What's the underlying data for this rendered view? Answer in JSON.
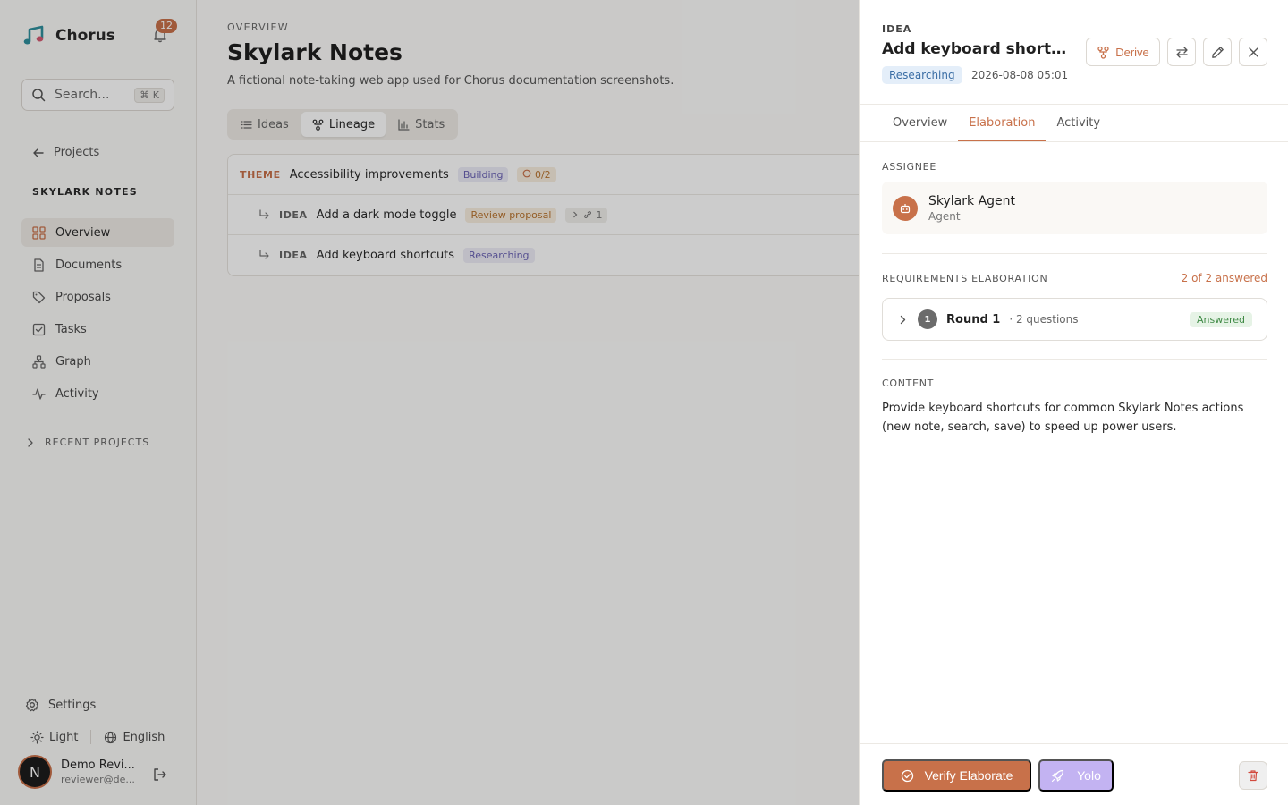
{
  "app": {
    "name": "Chorus",
    "notification_count": "12"
  },
  "colors": {
    "accent": "#c8714a",
    "overlay": "rgba(0,0,0,0.2)",
    "researching_bg": "#e4eef9",
    "yolo": "#c3b3f2"
  },
  "sidebar": {
    "search_placeholder": "Search...",
    "search_shortcut": "⌘ K",
    "back_label": "Projects",
    "project_heading": "SKYLARK NOTES",
    "nav": [
      {
        "label": "Overview",
        "icon": "grid-icon"
      },
      {
        "label": "Documents",
        "icon": "document-icon"
      },
      {
        "label": "Proposals",
        "icon": "tag-icon"
      },
      {
        "label": "Tasks",
        "icon": "checkbox-icon"
      },
      {
        "label": "Graph",
        "icon": "graph-icon"
      },
      {
        "label": "Activity",
        "icon": "pulse-icon"
      }
    ],
    "recent_label": "RECENT PROJECTS",
    "settings_label": "Settings",
    "theme_label": "Light",
    "language_label": "English",
    "user": {
      "initial": "N",
      "name": "Demo Revi...",
      "email": "reviewer@de..."
    }
  },
  "main": {
    "eyebrow": "OVERVIEW",
    "title": "Skylark Notes",
    "description": "A fictional note-taking web app used for Chorus documentation screenshots.",
    "tabs": [
      {
        "label": "Ideas",
        "icon": "list-icon"
      },
      {
        "label": "Lineage",
        "icon": "lineage-icon"
      },
      {
        "label": "Stats",
        "icon": "bar-chart-icon"
      }
    ],
    "lineage": {
      "theme": {
        "kind": "THEME",
        "title": "Accessibility improvements",
        "status": "Building",
        "progress": "0/2"
      },
      "ideas": [
        {
          "kind": "IDEA",
          "title": "Add a dark mode toggle",
          "status": "Review proposal",
          "links": "1"
        },
        {
          "kind": "IDEA",
          "title": "Add keyboard shortcuts",
          "status": "Researching"
        }
      ]
    }
  },
  "drawer": {
    "eyebrow": "IDEA",
    "title": "Add keyboard shortc...",
    "status": "Researching",
    "date": "2026-08-08 05:01",
    "derive_label": "Derive",
    "tabs": [
      "Overview",
      "Elaboration",
      "Activity"
    ],
    "assignee_label": "ASSIGNEE",
    "assignee": {
      "name": "Skylark Agent",
      "role": "Agent"
    },
    "requirements_label": "REQUIREMENTS ELABORATION",
    "answered_summary": "2 of 2 answered",
    "round": {
      "number": "1",
      "title": "Round 1",
      "questions": "· 2 questions",
      "status": "Answered"
    },
    "content_label": "CONTENT",
    "content": "Provide keyboard shortcuts for common Skylark Notes actions (new note, search, save) to speed up power users.",
    "verify_label": "Verify Elaborate",
    "yolo_label": "Yolo"
  }
}
